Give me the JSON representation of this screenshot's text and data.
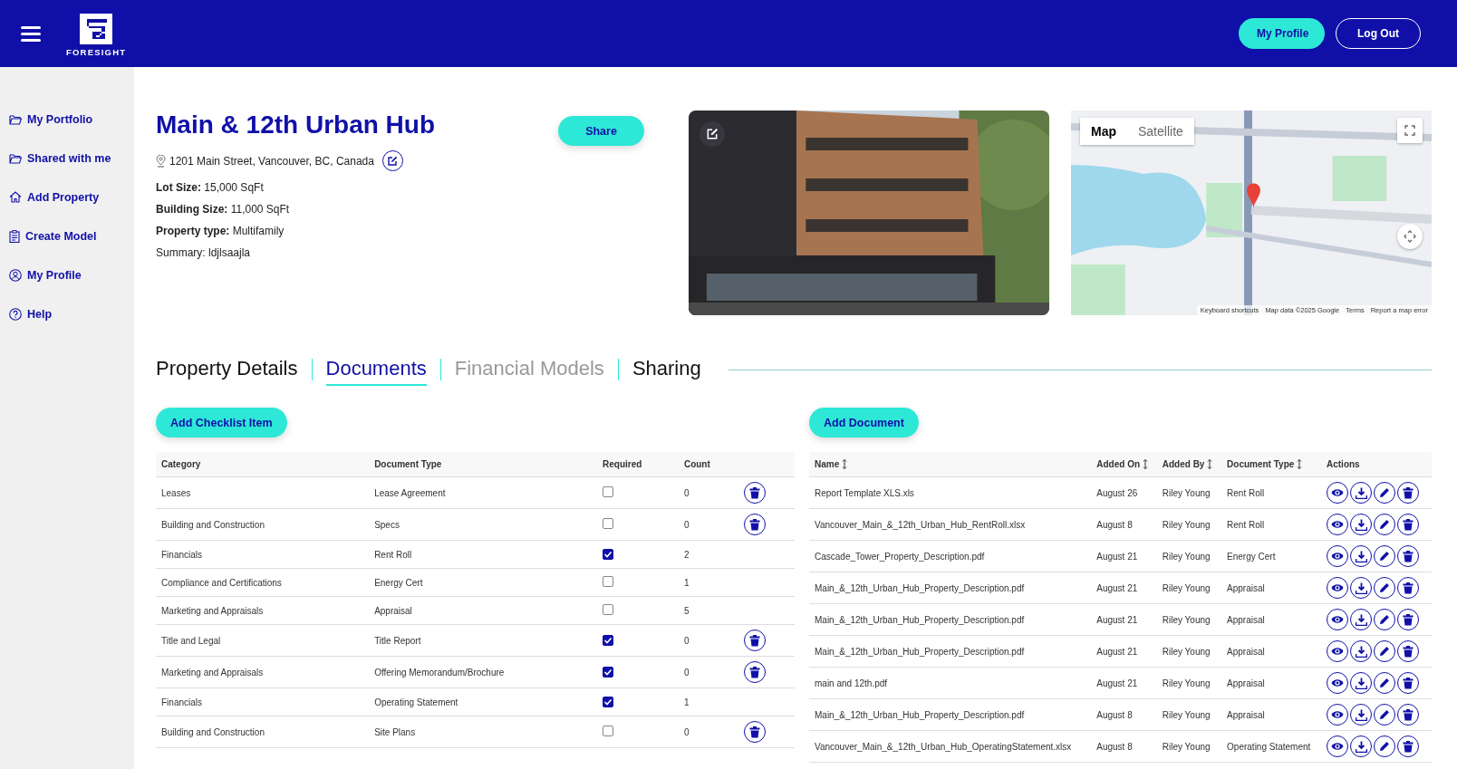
{
  "header": {
    "logo_text": "FORESIGHT",
    "buttons": [
      {
        "label": "My Profile",
        "kind": "filled"
      },
      {
        "label": "Log Out",
        "kind": "outline"
      }
    ]
  },
  "sidebar": {
    "items": [
      {
        "label": "My Portfolio"
      },
      {
        "label": "Shared with me"
      },
      {
        "label": "Add Property"
      },
      {
        "label": "Create Model"
      },
      {
        "label": "My Profile"
      },
      {
        "label": "Help"
      }
    ]
  },
  "property": {
    "title": "Main & 12th Urban Hub",
    "address": "1201 Main Street, Vancouver, BC, Canada",
    "details": [
      {
        "label": "Lot Size:",
        "value": "15,000 SqFt",
        "bold_label": true
      },
      {
        "label": "Building Size:",
        "value": "11,000 SqFt",
        "bold_label": true
      },
      {
        "label": "Property type:",
        "value": "Multifamily",
        "bold_label": true
      },
      {
        "label": "Summary:",
        "value": "ldjlsaajla",
        "bold_label": false
      }
    ],
    "share_button": "Share"
  },
  "map": {
    "types": [
      {
        "label": "Map",
        "selected": true
      },
      {
        "label": "Satellite",
        "selected": false
      }
    ],
    "attribution": [
      "Keyboard shortcuts",
      "Map data ©2025 Google",
      "Terms",
      "Report a map error"
    ]
  },
  "tabs": [
    {
      "label": "Property Details",
      "selected": false,
      "disabled": false
    },
    {
      "label": "Documents",
      "selected": true,
      "disabled": false
    },
    {
      "label": "Financial Models",
      "selected": false,
      "disabled": true
    },
    {
      "label": "Sharing",
      "selected": false,
      "disabled": false
    }
  ],
  "checklist": {
    "button": "Add Checklist Item",
    "columns": [
      "Category",
      "Document Type",
      "Required",
      "Count"
    ],
    "rows": [
      {
        "category": "Leases",
        "document_type": "Lease Agreement",
        "required": false,
        "count": "0",
        "deletable": true
      },
      {
        "category": "Building and Construction",
        "document_type": "Specs",
        "required": false,
        "count": "0",
        "deletable": true
      },
      {
        "category": "Financials",
        "document_type": "Rent Roll",
        "required": true,
        "count": "2",
        "deletable": false
      },
      {
        "category": "Compliance and Certifications",
        "document_type": "Energy Cert",
        "required": false,
        "count": "1",
        "deletable": false
      },
      {
        "category": "Marketing and Appraisals",
        "document_type": "Appraisal",
        "required": false,
        "count": "5",
        "deletable": false
      },
      {
        "category": "Title and Legal",
        "document_type": "Title Report",
        "required": true,
        "count": "0",
        "deletable": true
      },
      {
        "category": "Marketing and Appraisals",
        "document_type": "Offering Memorandum/Brochure",
        "required": true,
        "count": "0",
        "deletable": true
      },
      {
        "category": "Financials",
        "document_type": "Operating Statement",
        "required": true,
        "count": "1",
        "deletable": false
      },
      {
        "category": "Building and Construction",
        "document_type": "Site Plans",
        "required": false,
        "count": "0",
        "deletable": true
      }
    ]
  },
  "documents": {
    "button": "Add Document",
    "columns": [
      {
        "label": "Name",
        "sortable": true
      },
      {
        "label": "Added On",
        "sortable": true
      },
      {
        "label": "Added By",
        "sortable": true
      },
      {
        "label": "Document Type",
        "sortable": true
      },
      {
        "label": "Actions",
        "sortable": false
      }
    ],
    "rows": [
      {
        "name": "Report Template XLS.xls",
        "added_on": "August 26",
        "added_by": "Riley Young",
        "document_type": "Rent Roll"
      },
      {
        "name": "Vancouver_Main_&_12th_Urban_Hub_RentRoll.xlsx",
        "added_on": "August 8",
        "added_by": "Riley Young",
        "document_type": "Rent Roll"
      },
      {
        "name": "Cascade_Tower_Property_Description.pdf",
        "added_on": "August 21",
        "added_by": "Riley Young",
        "document_type": "Energy Cert"
      },
      {
        "name": "Main_&_12th_Urban_Hub_Property_Description.pdf",
        "added_on": "August 21",
        "added_by": "Riley Young",
        "document_type": "Appraisal"
      },
      {
        "name": "Main_&_12th_Urban_Hub_Property_Description.pdf",
        "added_on": "August 21",
        "added_by": "Riley Young",
        "document_type": "Appraisal"
      },
      {
        "name": "Main_&_12th_Urban_Hub_Property_Description.pdf",
        "added_on": "August 21",
        "added_by": "Riley Young",
        "document_type": "Appraisal"
      },
      {
        "name": "main and 12th.pdf",
        "added_on": "August 21",
        "added_by": "Riley Young",
        "document_type": "Appraisal"
      },
      {
        "name": "Main_&_12th_Urban_Hub_Property_Description.pdf",
        "added_on": "August 8",
        "added_by": "Riley Young",
        "document_type": "Appraisal"
      },
      {
        "name": "Vancouver_Main_&_12th_Urban_Hub_OperatingStatement.xlsx",
        "added_on": "August 8",
        "added_by": "Riley Young",
        "document_type": "Operating Statement"
      }
    ]
  }
}
